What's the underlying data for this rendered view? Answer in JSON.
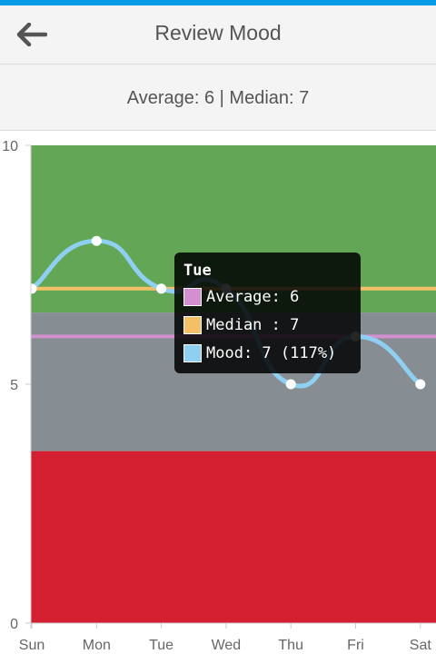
{
  "header": {
    "title": "Review Mood",
    "back_icon": "arrow-left-icon"
  },
  "summary": {
    "text": "Average: 6 | Median: 7"
  },
  "colors": {
    "accent": "#039be5",
    "band_good": "#62a656",
    "band_neutral": "#868e94",
    "band_bad": "#d41f30",
    "average": "#d48fd0",
    "median": "#f4c067",
    "mood": "#8ecff2"
  },
  "chart_data": {
    "type": "line",
    "categories": [
      "Sun",
      "Mon",
      "Tue",
      "Wed",
      "Thu",
      "Fri",
      "Sat"
    ],
    "ylim": [
      0,
      10
    ],
    "yticks": [
      "0",
      "5",
      "10"
    ],
    "bands": [
      {
        "from": 6.5,
        "to": 10,
        "color": "#62a656"
      },
      {
        "from": 3.6,
        "to": 6.5,
        "color": "#868e94"
      },
      {
        "from": 0,
        "to": 3.6,
        "color": "#d41f30"
      }
    ],
    "series": [
      {
        "name": "Mood",
        "values": [
          7,
          8,
          7,
          7,
          5,
          6,
          5
        ],
        "color": "#8ecff2"
      },
      {
        "name": "Median",
        "values": [
          7,
          7,
          7,
          7,
          7,
          7,
          7
        ],
        "color": "#f4c067"
      },
      {
        "name": "Average",
        "values": [
          6,
          6,
          6,
          6,
          6,
          6,
          6
        ],
        "color": "#d48fd0"
      }
    ]
  },
  "tooltip": {
    "title": "Tue",
    "rows": [
      {
        "label": "Average: 6",
        "color": "#d48fd0"
      },
      {
        "label": "Median : 7",
        "color": "#f4c067"
      },
      {
        "label": "Mood: 7 (117%)",
        "color": "#8ecff2"
      }
    ]
  }
}
